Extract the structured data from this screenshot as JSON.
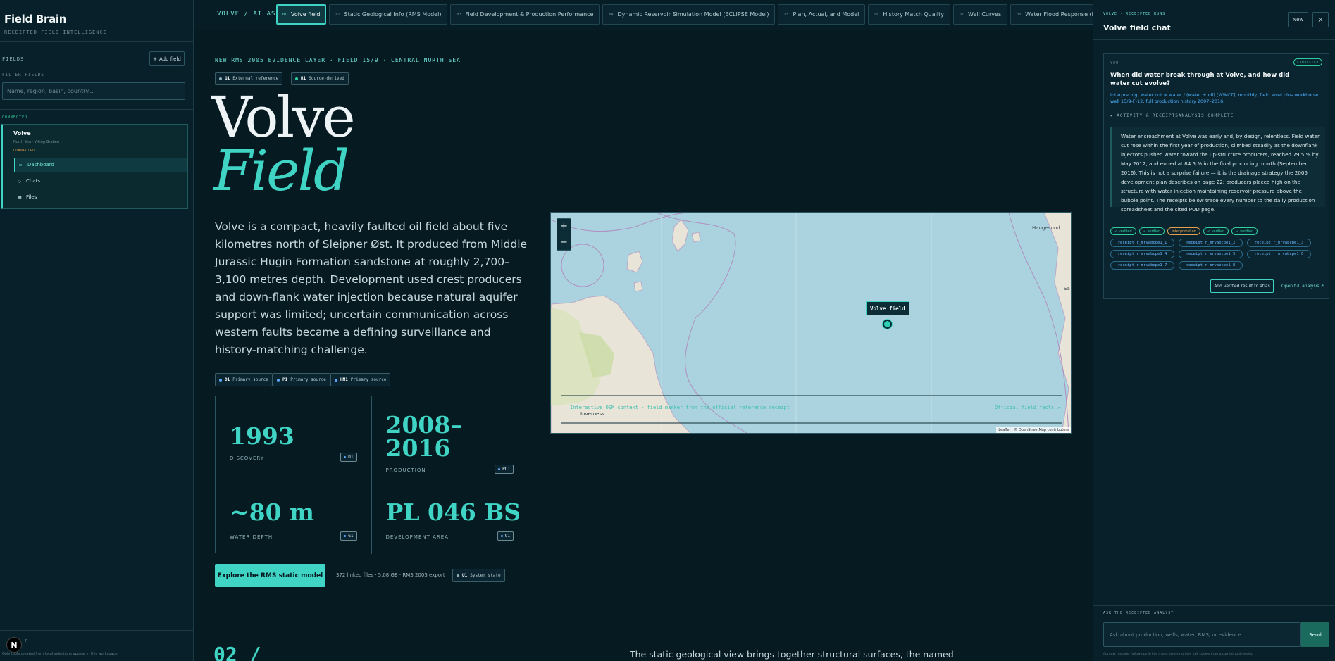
{
  "sidebar": {
    "brand": "Field Brain",
    "brand_sub": "RECEIPTED FIELD INTELLIGENCE",
    "fields_label": "FIELDS",
    "add_field_label": "Add field",
    "filter_label": "FILTER FIELDS",
    "filter_placeholder": "Name, region, basin, country...",
    "connected_label": "CONNECTED",
    "field": {
      "name": "Volve",
      "location": "North Sea · Viking Graben",
      "status": "CONNECTED",
      "nav": [
        {
          "label": "Dashboard",
          "icon": "dashboard-icon",
          "active": true
        },
        {
          "label": "Chats",
          "icon": "chat-icon",
          "active": false
        },
        {
          "label": "Files",
          "icon": "files-icon",
          "active": false
        }
      ]
    },
    "footer_mini": "R",
    "footer_text": "Only tools created from local selections appear in this workspace.",
    "logo_letter": "N"
  },
  "topnav": {
    "crumb": "VOLVE / ATLAS",
    "tabs": [
      {
        "num": "01",
        "label": "Volve field",
        "active": true
      },
      {
        "num": "02",
        "label": "Static Geological Info (RMS Model)",
        "active": false
      },
      {
        "num": "03",
        "label": "Field Development & Production Performance",
        "active": false
      },
      {
        "num": "04",
        "label": "Dynamic Reservoir Simulation Model (ECLIPSE Model)",
        "active": false
      },
      {
        "num": "05",
        "label": "Plan, Actual, and Model",
        "active": false
      },
      {
        "num": "06",
        "label": "History Match Quality",
        "active": false
      },
      {
        "num": "07",
        "label": "Well Curves",
        "active": false
      },
      {
        "num": "08",
        "label": "Water Flood Response (Pressure Support Made the Fie",
        "active": false
      }
    ]
  },
  "main": {
    "kicker": "NEW RMS 2005 EVIDENCE LAYER · FIELD 15/9 · CENTRAL NORTH SEA",
    "chips_top": [
      {
        "code": "G1",
        "label": "External reference"
      },
      {
        "code": "R1",
        "label": "Source-derived"
      }
    ],
    "hero_line1": "Volve",
    "hero_line2": "Field",
    "description": "Volve is a compact, heavily faulted oil field about five kilometres north of Sleipner Øst. It produced from Middle Jurassic Hugin Formation sandstone at roughly 2,700–3,100 metres depth. Development used crest producers and down-flank water injection because natural aquifer support was limited; uncertain communication across western faults became a defining surveillance and history-matching challenge.",
    "chips_mid": [
      {
        "code": "D1",
        "label": "Primary source"
      },
      {
        "code": "P1",
        "label": "Primary source"
      },
      {
        "code": "HM1",
        "label": "Primary source"
      }
    ],
    "stats": [
      {
        "value": "1993",
        "label": "DISCOVERY",
        "tag": "D1"
      },
      {
        "value_line1": "2008–",
        "value_line2": "2016",
        "label": "PRODUCTION",
        "tag": "PD1"
      },
      {
        "value": "~80 m",
        "label": "WATER DEPTH",
        "tag": "G1"
      },
      {
        "value": "PL 046 BS",
        "label": "DEVELOPMENT AREA",
        "tag": "G1"
      }
    ],
    "cta_label": "Explore the RMS static model",
    "cta_note": "372 linked files · 5.08 GB · RMS 2005 export",
    "cta_chip": {
      "code": "U1",
      "label": "System state"
    },
    "section_num": "02 /",
    "section_text": "The static geological view brings together structural surfaces, the named"
  },
  "map": {
    "zoom_in": "+",
    "zoom_out": "−",
    "marker_label": "Volve field",
    "caption": "Interactive OSM context · field marker from the official reference receipt",
    "caption_city": "Inverness",
    "link": "Official field facts ↗",
    "city_haugesund": "Haugesund",
    "city_right": "Sa",
    "attribution": "Leaflet | © OpenStreetMap contributors",
    "colors": {
      "sea": "#a9d3df",
      "land": "#e9e4d8",
      "accent": "#3fd4c4"
    }
  },
  "chat": {
    "crumb": "VOLVE · RECEIPTED RUNS",
    "title": "Volve field chat",
    "new_label": "New",
    "close_label": "×",
    "you_label": "YOU",
    "status": "COMPLETED",
    "question": "When did water break through at Volve, and how did water cut evolve?",
    "interpretation": "Interpreting: water cut = water / (water + oil) [WWCT], monthly, field level plus workhorse well 15/9-F-12, full production history 2007–2016.",
    "activity": "▸ ACTIVITY & RECEIPTSANALYSIS COMPLETE",
    "answer": "Water encroachment at Volve was early and, by design, relentless. Field water cut rose within the first year of production, climbed steadily as the downflank injectors pushed water toward the up-structure producers, reached 79.5 % by May 2012, and ended at 84.5 % in the final producing month (September 2016). This is not a surprise failure — it is the drainage strategy the 2005 development plan describes on page 22: producers placed high on the structure with water injection maintaining reservoir pressure above the bubble point. The receipts below trace every number to the daily production spreadsheet and the cited PUD page.",
    "badges": [
      {
        "label": "✓ verified",
        "kind": "ok"
      },
      {
        "label": "✓ verified",
        "kind": "ok"
      },
      {
        "label": "interpretation",
        "kind": "warn"
      },
      {
        "label": "✓ verified",
        "kind": "ok"
      },
      {
        "label": "✓ verified",
        "kind": "ok"
      }
    ],
    "receipts": [
      "receipt r_mrvabcpe1_1",
      "receipt r_mrvabcpe1_2",
      "receipt r_mrvabcpe1_3",
      "receipt r_mrvabcpe1_4",
      "receipt r_mrvabcpe1_5",
      "receipt r_mrvabcpe1_6",
      "receipt r_mrvabcpe1_7",
      "receipt r_mrvabcpe1_8"
    ],
    "add_verified_label": "Add verified result to atlas",
    "open_analysis_label": "Open full analysis ↗",
    "ask_label": "ASK THE RECEIPTED ANALYST",
    "ask_placeholder": "Ask about production, wells, water, RMS, or evidence...",
    "send_label": "Send",
    "ask_footer": "Context resolves follow-ups in live mode; every number still comes from a current tool receipt."
  }
}
